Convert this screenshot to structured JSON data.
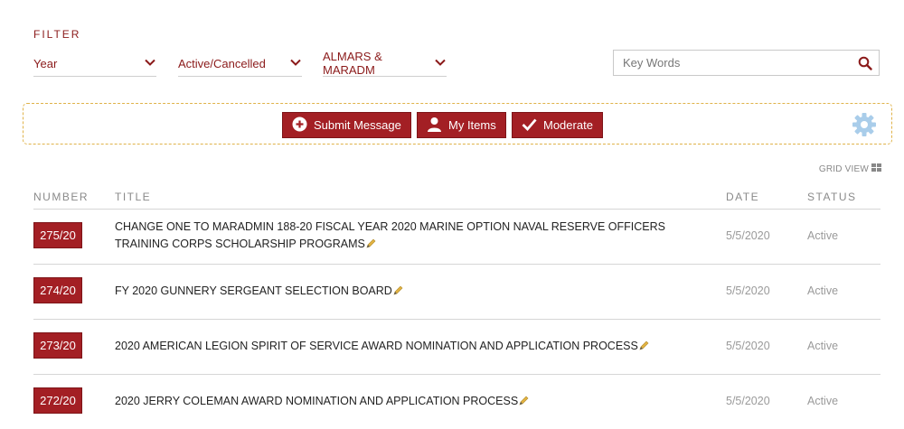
{
  "filter": {
    "title": "FILTER",
    "year_label": "Year",
    "status_label": "Active/Cancelled",
    "type_label": "ALMARS & MARADM",
    "search_placeholder": "Key Words"
  },
  "actions": {
    "submit_label": "Submit Message",
    "my_items_label": "My Items",
    "moderate_label": "Moderate"
  },
  "view": {
    "grid_view_label": "GRID VIEW"
  },
  "table": {
    "headers": {
      "number": "NUMBER",
      "title": "TITLE",
      "date": "DATE",
      "status": "STATUS"
    },
    "rows": [
      {
        "number": "275/20",
        "title_line1": "CHANGE ONE TO MARADMIN 188-20 FISCAL YEAR 2020 MARINE OPTION NAVAL RESERVE OFFICERS",
        "title_line2": "TRAINING CORPS SCHOLARSHIP PROGRAMS",
        "date": "5/5/2020",
        "status": "Active"
      },
      {
        "number": "274/20",
        "title": "FY 2020 GUNNERY SERGEANT SELECTION BOARD",
        "date": "5/5/2020",
        "status": "Active"
      },
      {
        "number": "273/20",
        "title": "2020 AMERICAN LEGION SPIRIT OF SERVICE AWARD NOMINATION AND APPLICATION PROCESS",
        "date": "5/5/2020",
        "status": "Active"
      },
      {
        "number": "272/20",
        "title": "2020 JERRY COLEMAN AWARD NOMINATION AND APPLICATION PROCESS",
        "date": "5/5/2020",
        "status": "Active"
      }
    ]
  },
  "colors": {
    "accent": "#a31f24",
    "border_dashed": "#e0b34a",
    "gear": "#a9cdea",
    "muted": "#9a9a9a"
  }
}
